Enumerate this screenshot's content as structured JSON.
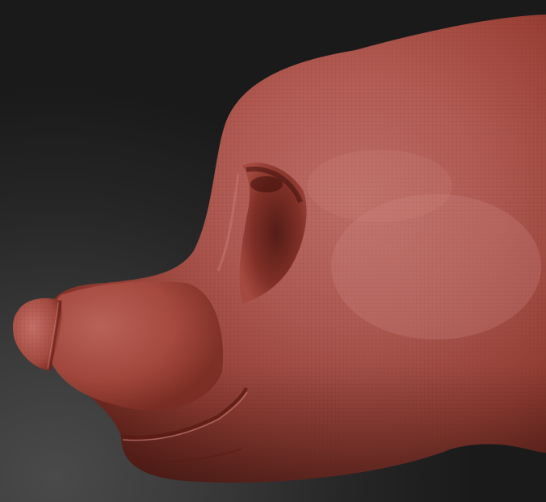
{
  "viewport": {
    "background_color": "#262626",
    "subject": "sculpt-mesh",
    "material_color": "#a8453a",
    "highlight_color": "#c9776f",
    "shadow_color": "#5e1e18"
  }
}
